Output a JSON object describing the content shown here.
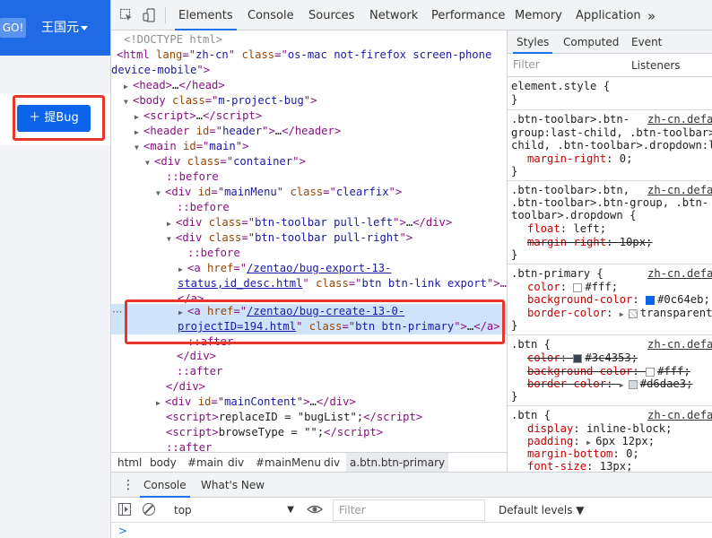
{
  "page": {
    "go_label": "GO!",
    "user_name": "王国元",
    "report_bug_label": "提Bug"
  },
  "toolbar": {
    "tabs": [
      "Elements",
      "Console",
      "Sources",
      "Network",
      "Performance",
      "Memory",
      "Application"
    ],
    "more": "»"
  },
  "tree": {
    "doctype": "<!DOCTYPE html>",
    "html_lang": "zh-cn",
    "html_class_a": "os-mac not-firefox screen-phone",
    "html_class_b": "device-mobile",
    "body_class": "m-project-bug",
    "header_id": "header",
    "main_id": "main",
    "container_class": "container",
    "mainmenu_id": "mainMenu",
    "mainmenu_class": "clearfix",
    "toolbar_left_class": "btn-toolbar pull-left",
    "toolbar_right_class": "btn-toolbar pull-right",
    "export_href_a": "/zentao/bug-export-13-",
    "export_href_b": "status,id_desc.html",
    "export_class": "btn btn-link export",
    "create_href_a": "/zentao/bug-create-13-0-",
    "create_href_b": "projectID=194.html",
    "create_class": "btn btn-primary",
    "maincontent_id": "mainContent",
    "script_replace": "replaceID = \"bugList\";",
    "script_browse": "browseType = \"\";",
    "before": "::before",
    "after": "::after"
  },
  "breadcrumbs": [
    "html",
    "body",
    "#main",
    "div",
    "#mainMenu",
    "div",
    "a.btn.btn-primary"
  ],
  "styles": {
    "tabs": [
      "Styles",
      "Computed",
      "Event Listeners"
    ],
    "filter_placeholder": "Filter",
    "element_style": "element.style {",
    "close_brace": "}",
    "rule1_sel_a": ".btn-toolbar>.btn-",
    "rule1_sel_b": "group:last-child, .btn-toolbar>",
    "rule1_sel_c": "child, .btn-toolbar>.dropdown:l",
    "rule1_src": "zh-cn.defa",
    "rule1_prop": "margin-right",
    "rule1_val": "0;",
    "rule2_sel_a": ".btn-toolbar>.btn,",
    "rule2_sel_b": ".btn-toolbar>.btn-group, .btn-",
    "rule2_sel_c": "toolbar>.dropdown {",
    "rule2_src": "zh-cn.defa",
    "rule2_prop1": "float",
    "rule2_val1": "left;",
    "rule2_prop2": "margin-right",
    "rule2_val2": "10px;",
    "rule3_sel": ".btn-primary {",
    "rule3_src": "zh-cn.defa",
    "rule3_prop1": "color",
    "rule3_val1": "#fff;",
    "rule3_prop2": "background-color",
    "rule3_val2": "#0c64eb;",
    "rule3_prop3": "border-color",
    "rule3_val3": "transparent;",
    "rule4_sel": ".btn {",
    "rule4_src": "zh-cn.defa",
    "rule4_prop1": "color",
    "rule4_val1": "#3c4353;",
    "rule4_prop2": "background-color",
    "rule4_val2": "#fff;",
    "rule4_prop3": "border-color",
    "rule4_val3": "#d6dae3;",
    "rule5_sel": ".btn {",
    "rule5_src": "zh-cn.defa",
    "rule5_prop1": "display",
    "rule5_val1": "inline-block;",
    "rule5_prop2": "padding",
    "rule5_val2": "6px 12px;",
    "rule5_prop3": "margin-bottom",
    "rule5_val3": "0;",
    "rule5_prop4": "font-size",
    "rule5_val4": "13px;"
  },
  "drawer": {
    "tabs": [
      "Console",
      "What's New"
    ],
    "context": "top",
    "filter_placeholder": "Filter",
    "levels": "Default levels ▼",
    "prompt": ">"
  },
  "colors": {
    "primary": "#0c64eb",
    "header_blue": "#1f6be6",
    "highlight_red": "#e8362a",
    "selected_row": "#cfe3fb",
    "swatch_primary": "#0c64eb",
    "swatch_dark": "#3c4353",
    "swatch_border": "#d6dae3",
    "swatch_white": "#ffffff"
  }
}
